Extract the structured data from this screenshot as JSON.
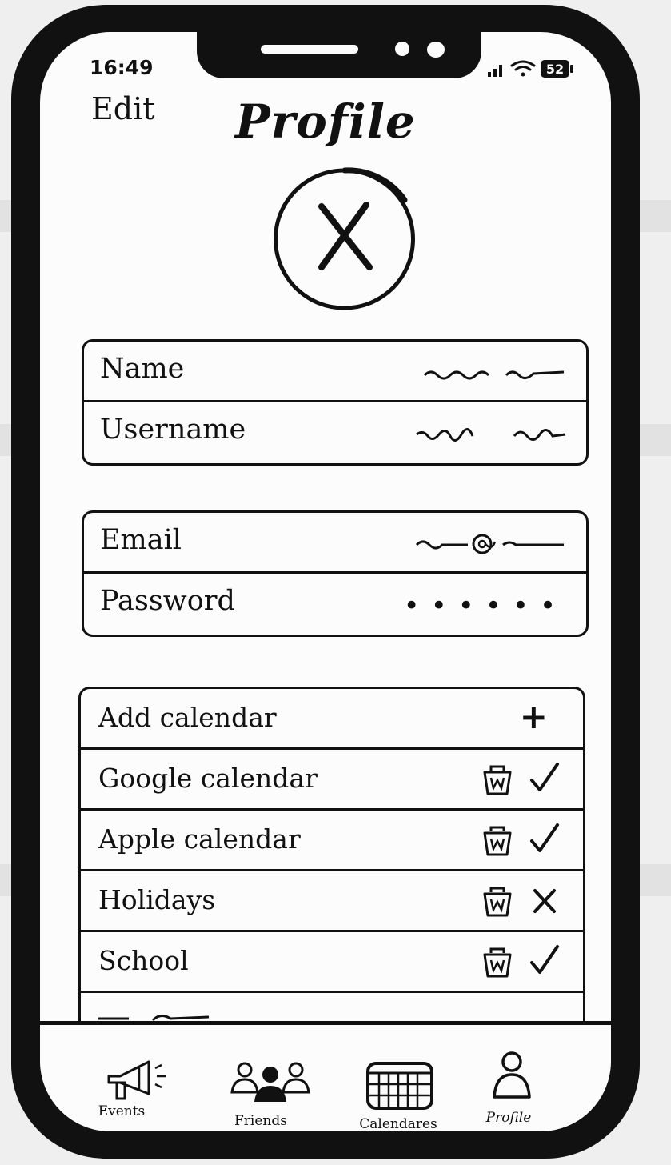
{
  "status_bar": {
    "time": "16:49",
    "battery": "52"
  },
  "header": {
    "edit_label": "Edit",
    "title": "Profile"
  },
  "avatar": {
    "icon": "close-icon"
  },
  "account_info": {
    "rows": [
      {
        "label": "Name"
      },
      {
        "label": "Username"
      }
    ]
  },
  "credentials": {
    "rows": [
      {
        "label": "Email"
      },
      {
        "label": "Password",
        "value": "••••••"
      }
    ]
  },
  "calendars": {
    "add_label": "Add calendar",
    "add_icon": "+",
    "items": [
      {
        "label": "Google calendar",
        "enabled": true
      },
      {
        "label": "Apple calendar",
        "enabled": true
      },
      {
        "label": "Holidays",
        "enabled": false
      },
      {
        "label": "School",
        "enabled": true
      }
    ]
  },
  "tabbar": {
    "tabs": [
      {
        "label": "Events",
        "icon": "megaphone-icon"
      },
      {
        "label": "Friends",
        "icon": "people-icon"
      },
      {
        "label": "Calendares",
        "icon": "calendar-icon"
      },
      {
        "label": "Profile",
        "icon": "person-icon"
      }
    ]
  }
}
